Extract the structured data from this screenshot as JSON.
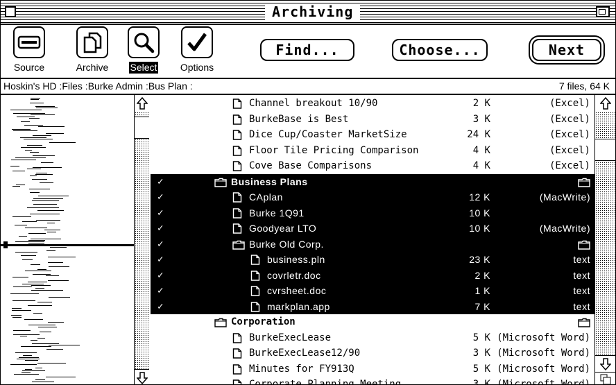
{
  "window": {
    "title": "Archiving"
  },
  "toolbar": {
    "tools": [
      {
        "label": "Source",
        "icon": "drive-icon",
        "selected": false
      },
      {
        "label": "Archive",
        "icon": "documents-icon",
        "selected": false
      },
      {
        "label": "Select",
        "icon": "magnifier-icon",
        "selected": true
      },
      {
        "label": "Options",
        "icon": "checkmark-icon",
        "selected": false
      }
    ],
    "find_label": "Find...",
    "choose_label": "Choose...",
    "next_label": "Next"
  },
  "pathbar": {
    "path": "Hoskin's HD :Files :Burke Admin :Bus Plan :",
    "count": "7 files, 64 K"
  },
  "files": [
    {
      "name": "Channel breakout 10/90",
      "size": "2 K",
      "kind": "(Excel)",
      "type": "doc",
      "indent": 0,
      "checked": false,
      "selected": false
    },
    {
      "name": "BurkeBase is Best",
      "size": "3 K",
      "kind": "(Excel)",
      "type": "doc",
      "indent": 0,
      "checked": false,
      "selected": false
    },
    {
      "name": "Dice Cup/Coaster MarketSize",
      "size": "24 K",
      "kind": "(Excel)",
      "type": "doc",
      "indent": 0,
      "checked": false,
      "selected": false
    },
    {
      "name": "Floor Tile Pricing Comparison",
      "size": "4 K",
      "kind": "(Excel)",
      "type": "doc",
      "indent": 0,
      "checked": false,
      "selected": false
    },
    {
      "name": "Cove Base Comparisons",
      "size": "4 K",
      "kind": "(Excel)",
      "type": "doc",
      "indent": 0,
      "checked": false,
      "selected": false
    },
    {
      "name": "Business Plans",
      "size": "",
      "kind": "",
      "type": "folder",
      "indent": -1,
      "checked": true,
      "selected": true,
      "bold": true
    },
    {
      "name": "CAplan",
      "size": "12 K",
      "kind": "(MacWrite)",
      "type": "doc",
      "indent": 0,
      "checked": true,
      "selected": true
    },
    {
      "name": "Burke 1Q91",
      "size": "10 K",
      "kind": "",
      "type": "doc",
      "indent": 0,
      "checked": true,
      "selected": true
    },
    {
      "name": "Goodyear LTO",
      "size": "10 K",
      "kind": "(MacWrite)",
      "type": "doc",
      "indent": 0,
      "checked": true,
      "selected": true
    },
    {
      "name": "Burke Old Corp.",
      "size": "",
      "kind": "",
      "type": "folder",
      "indent": 0,
      "checked": true,
      "selected": true
    },
    {
      "name": "business.pln",
      "size": "23 K",
      "kind": "text",
      "type": "doc",
      "indent": 1,
      "checked": true,
      "selected": true
    },
    {
      "name": "covrletr.doc",
      "size": "2 K",
      "kind": "text",
      "type": "doc",
      "indent": 1,
      "checked": true,
      "selected": true
    },
    {
      "name": "cvrsheet.doc",
      "size": "1 K",
      "kind": "text",
      "type": "doc",
      "indent": 1,
      "checked": true,
      "selected": true
    },
    {
      "name": "markplan.app",
      "size": "7 K",
      "kind": "text",
      "type": "doc",
      "indent": 1,
      "checked": true,
      "selected": true
    },
    {
      "name": "Corporation",
      "size": "",
      "kind": "",
      "type": "folder",
      "indent": -1,
      "checked": false,
      "selected": false,
      "bold": true
    },
    {
      "name": "BurkeExecLease",
      "size": "5 K",
      "kind": "(Microsoft Word)",
      "type": "doc",
      "indent": 0,
      "checked": false,
      "selected": false
    },
    {
      "name": "BurkeExecLease12/90",
      "size": "3 K",
      "kind": "(Microsoft Word)",
      "type": "doc",
      "indent": 0,
      "checked": false,
      "selected": false
    },
    {
      "name": "Minutes for FY913Q",
      "size": "5 K",
      "kind": "(Microsoft Word)",
      "type": "doc",
      "indent": 0,
      "checked": false,
      "selected": false
    },
    {
      "name": "Corporate Planning Meeting",
      "size": "3 K",
      "kind": "(Microsoft Word)",
      "type": "doc",
      "indent": 0,
      "checked": false,
      "selected": false
    }
  ],
  "check_glyph": "✓",
  "tree_scroll_position": 0.02,
  "list_scroll_position": 0.12
}
